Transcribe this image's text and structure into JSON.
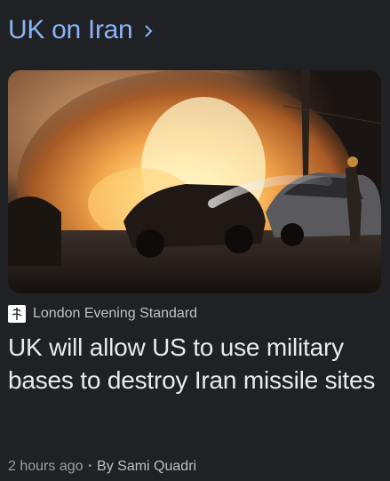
{
  "topic": {
    "title": "UK on Iran",
    "chevron_icon": "chevron-right-icon",
    "color": "#8ab4f8"
  },
  "article": {
    "image_alt": "Burning cars at night",
    "source_icon": "london-evening-standard-logo",
    "source": "London Evening Standard",
    "headline": "UK will allow US to use military bases to destroy Iran missile sites",
    "time": "2 hours ago",
    "separator": "•",
    "author": "By Sami Quadri"
  },
  "colors": {
    "background": "#202124",
    "link": "#8ab4f8",
    "text": "#e8eaed",
    "secondary_text": "#9aa0a6"
  }
}
